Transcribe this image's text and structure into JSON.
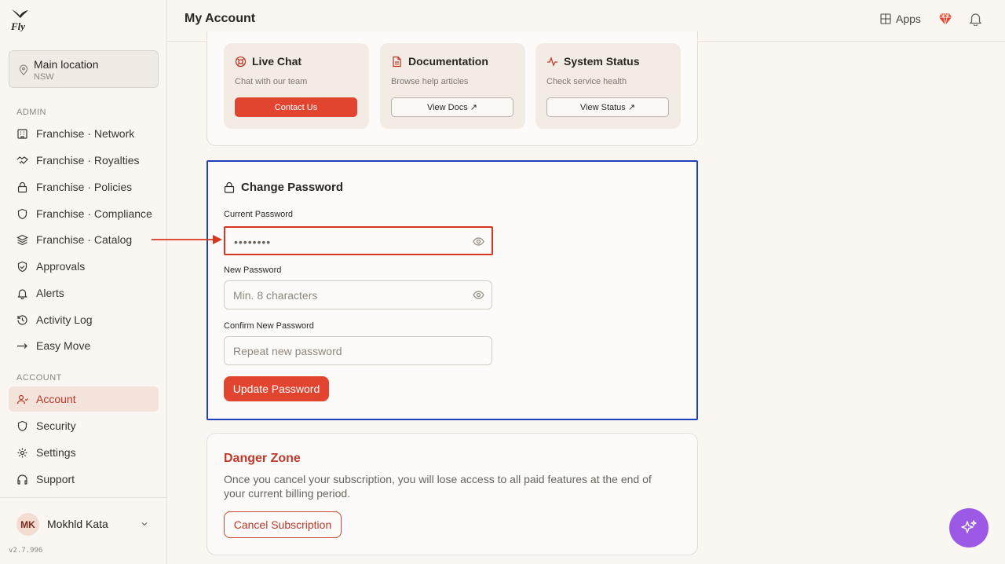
{
  "app": {
    "logo_text": "fly",
    "version": "v2.7.996"
  },
  "location": {
    "name": "Main location",
    "region": "NSW"
  },
  "sidebar": {
    "admin_label": "ADMIN",
    "admin_items": [
      {
        "label": "Franchise · Network",
        "icon": "building-icon"
      },
      {
        "label": "Franchise · Royalties",
        "icon": "handshake-icon"
      },
      {
        "label": "Franchise · Policies",
        "icon": "lock-icon"
      },
      {
        "label": "Franchise · Compliance",
        "icon": "shield-icon"
      },
      {
        "label": "Franchise · Catalog",
        "icon": "layers-icon"
      },
      {
        "label": "Approvals",
        "icon": "shield-check-icon"
      },
      {
        "label": "Alerts",
        "icon": "bell-icon"
      },
      {
        "label": "Activity Log",
        "icon": "history-icon"
      },
      {
        "label": "Easy Move",
        "icon": "arrow-right-icon"
      }
    ],
    "account_label": "ACCOUNT",
    "account_items": [
      {
        "label": "Account",
        "icon": "user-icon",
        "active": true
      },
      {
        "label": "Security",
        "icon": "shield-icon"
      },
      {
        "label": "Settings",
        "icon": "gear-icon"
      },
      {
        "label": "Support",
        "icon": "headset-icon"
      }
    ]
  },
  "user": {
    "initials": "MK",
    "name": "Mokhld Kata"
  },
  "header": {
    "title": "My Account",
    "apps_label": "Apps"
  },
  "support": {
    "tiles": [
      {
        "title": "Live Chat",
        "subtitle": "Chat with our team",
        "button": "Contact Us",
        "icon": "lifebuoy-icon"
      },
      {
        "title": "Documentation",
        "subtitle": "Browse help articles",
        "button": "View Docs ↗",
        "icon": "document-icon"
      },
      {
        "title": "System Status",
        "subtitle": "Check service health",
        "button": "View Status ↗",
        "icon": "activity-icon"
      }
    ]
  },
  "password": {
    "title": "Change Password",
    "current_label": "Current Password",
    "current_value": "••••••••",
    "new_label": "New Password",
    "new_placeholder": "Min. 8 characters",
    "confirm_label": "Confirm New Password",
    "confirm_placeholder": "Repeat new password",
    "submit": "Update Password"
  },
  "danger": {
    "title": "Danger Zone",
    "text": "Once you cancel your subscription, you will lose access to all paid features at the end of your current billing period.",
    "button": "Cancel Subscription"
  },
  "colors": {
    "accent": "#e2452f",
    "highlight_box": "#1f3fbf",
    "fab": "#9b59e6"
  }
}
